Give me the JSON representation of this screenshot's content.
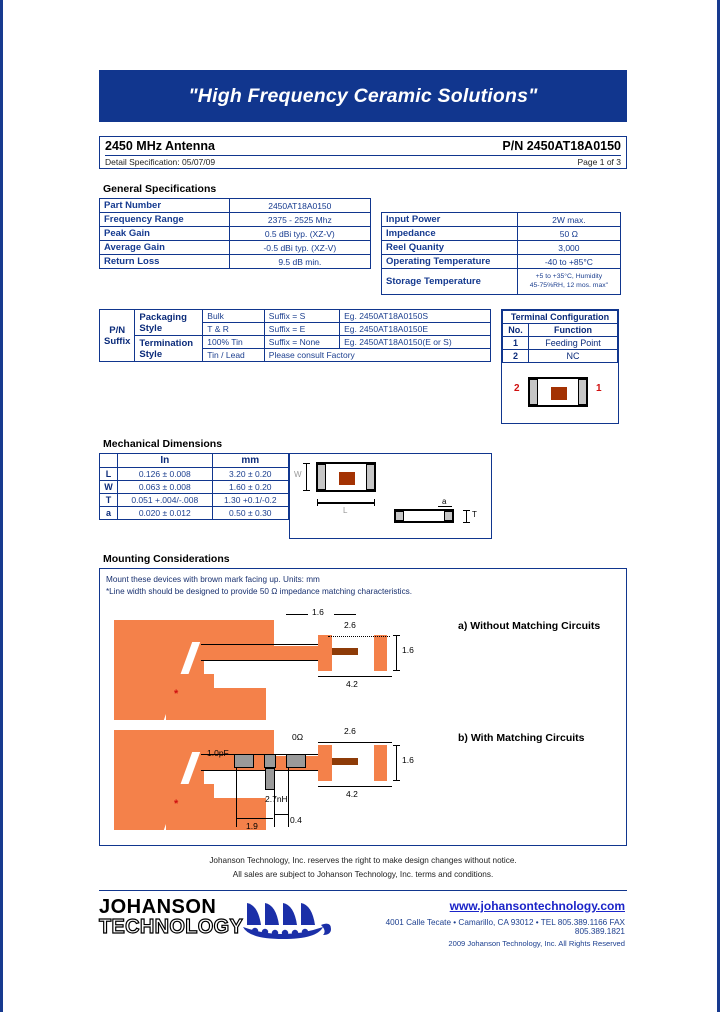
{
  "banner": {
    "slogan": "\"High Frequency Ceramic Solutions\""
  },
  "title_block": {
    "product": "2450 MHz Antenna",
    "part_number": "P/N 2450AT18A0150",
    "detail_spec": "Detail Specification:   05/07/09",
    "page": "Page 1 of 3"
  },
  "general_specs": {
    "heading": "General Specifications",
    "left_rows": [
      {
        "label": "Part Number",
        "value": "2450AT18A0150"
      },
      {
        "label": "Frequency Range",
        "value": "2375 - 2525 Mhz"
      },
      {
        "label": "Peak Gain",
        "value": "0.5 dBi typ. (XZ-V)"
      },
      {
        "label": "Average Gain",
        "value": "-0.5 dBi typ. (XZ-V)"
      },
      {
        "label": "Return Loss",
        "value": "9.5 dB min."
      }
    ],
    "right_rows": [
      {
        "label": "Input Power",
        "value": "2W max."
      },
      {
        "label": "Impedance",
        "value": "50 Ω"
      },
      {
        "label": "Reel Quanity",
        "value": "3,000"
      },
      {
        "label": "Operating Temperature",
        "value": "-40 to +85°C"
      },
      {
        "label": "Storage Temperature",
        "value_line1": "+5 to +35°C, Humidity",
        "value_line2": "45-75%RH, 12 mos. max\""
      }
    ]
  },
  "suffix_table": {
    "pn_label_line1": "P/N",
    "pn_label_line2": "Suffix",
    "rows": [
      {
        "style": "Packaging Style",
        "kind": "Bulk",
        "suffix": "Suffix = S",
        "eg": "Eg. 2450AT18A0150S"
      },
      {
        "style": "",
        "kind": "T & R",
        "suffix": "Suffix = E",
        "eg": "Eg. 2450AT18A0150E"
      },
      {
        "style": "Termination Style",
        "kind": "100% Tin",
        "suffix": "Suffix = None",
        "eg": "Eg. 2450AT18A0150(E or S)"
      },
      {
        "style": "",
        "kind": "Tin / Lead",
        "suffix": "Please consult Factory",
        "eg": ""
      }
    ],
    "style_labels": {
      "packaging": "Packaging Style",
      "termination": "Termination Style"
    }
  },
  "terminal_config": {
    "heading": "Terminal Configuration",
    "col_no": "No.",
    "col_function": "Function",
    "rows": [
      {
        "no": "1",
        "function": "Feeding Point"
      },
      {
        "no": "2",
        "function": "NC"
      }
    ],
    "diagram_left_label": "2",
    "diagram_right_label": "1"
  },
  "mechanical": {
    "heading": "Mechanical Dimensions",
    "col_in": "In",
    "col_mm": "mm",
    "rows": [
      {
        "sym": "L",
        "in": "0.126  ±  0.008",
        "mm": "3.20  ±  0.20"
      },
      {
        "sym": "W",
        "in": "0.063  ±  0.008",
        "mm": "1.60  ±  0.20"
      },
      {
        "sym": "T",
        "in": "0.051 +.004/-.008",
        "mm": "1.30   +0.1/-0.2"
      },
      {
        "sym": "a",
        "in": "0.020  ±  0.012",
        "mm": "0.50  ±  0.30"
      }
    ],
    "fig_labels": {
      "w": "W",
      "l": "L",
      "a": "a",
      "t": "T"
    }
  },
  "mounting": {
    "heading": "Mounting Considerations",
    "note1": "Mount these devices with brown mark facing up. Units: mm",
    "note2": "*Line width should be designed to provide 50 Ω impedance matching characteristics.",
    "caption_a": "a) Without Matching Circuits",
    "caption_b": "b) With Matching Circuits",
    "dims_a": {
      "line_width": "1.6",
      "pad_gap": "2.6",
      "overall": "4.2",
      "height": "1.6"
    },
    "dims_b": {
      "pad_gap": "2.6",
      "overall": "4.2",
      "height": "1.6",
      "pad_pitch": "1.9",
      "pad_width": "0.4"
    },
    "components": {
      "series_cap": "1.0pF",
      "shunt_ind": "2.7nH",
      "res": "0Ω"
    },
    "star": "*"
  },
  "footer": {
    "disclaimer1": "Johanson Technology, Inc. reserves the right to make design changes without notice.",
    "disclaimer2": "All sales are subject to Johanson Technology, Inc. terms and conditions.",
    "logo_line1": "JOHANSON",
    "logo_line2": "TECHNOLOGY",
    "website": "www.johansontechnology.com",
    "address": "4001 Calle Tecate • Camarillo, CA 93012 •   TEL 805.389.1166 FAX 805.389.1821",
    "copyright": "2009 Johanson Technology, Inc.   All Rights Reserved"
  },
  "colors": {
    "brand_blue": "#11368e",
    "copper": "#f4814a",
    "brown_mark": "#8d3b08",
    "link_blue": "#1b24c8"
  }
}
